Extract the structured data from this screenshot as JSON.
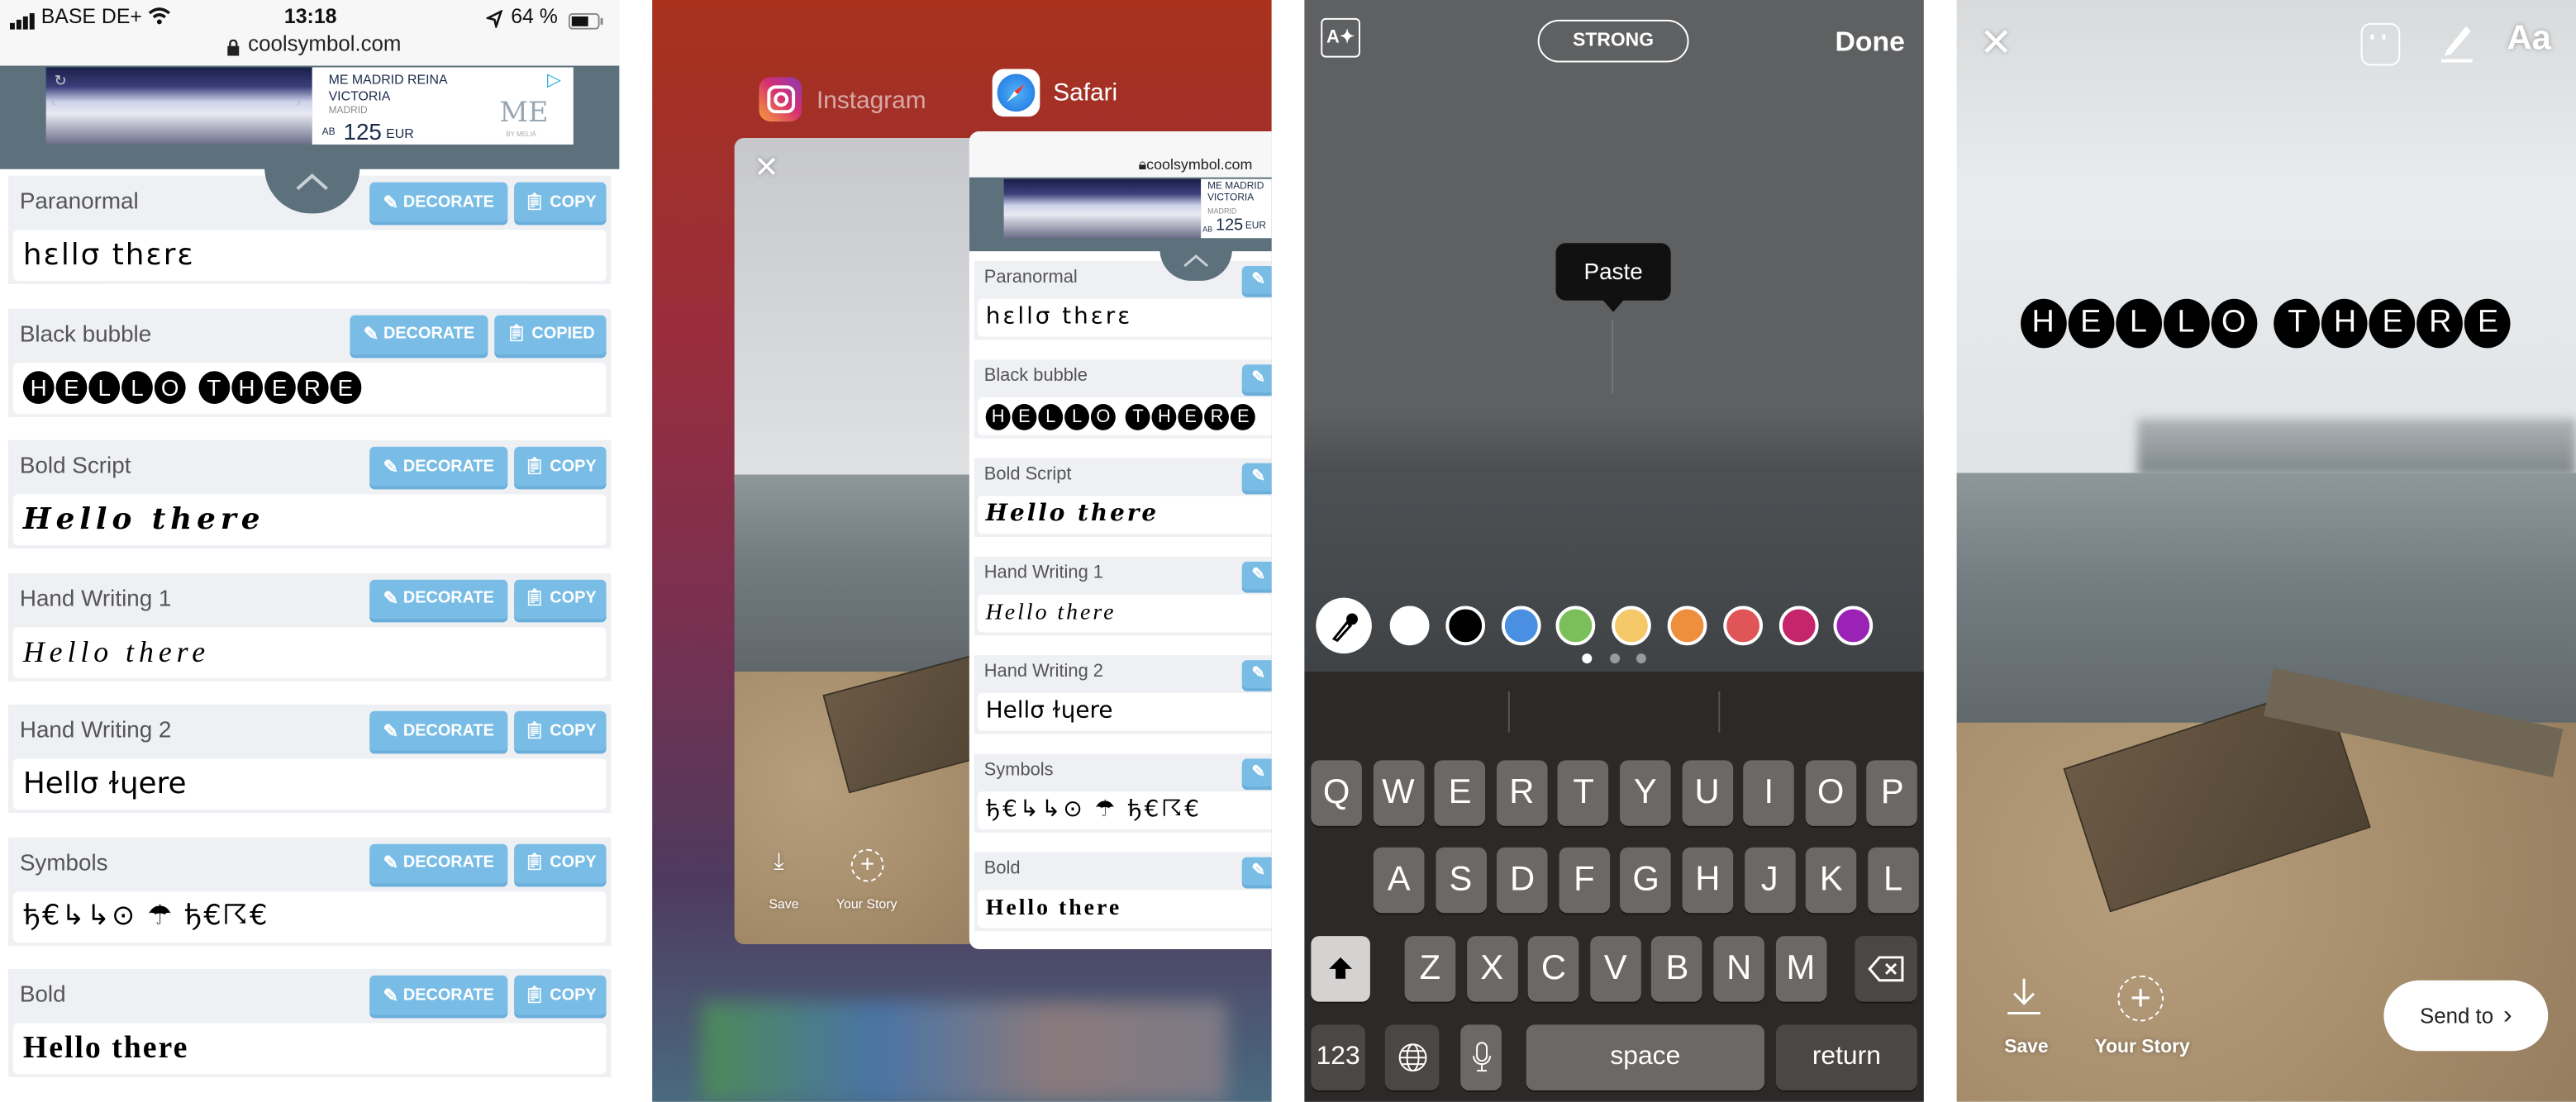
{
  "coolsymbol": {
    "status": {
      "carrier": "BASE DE+",
      "time": "13:18",
      "battery": "64 %"
    },
    "url": "coolsymbol.com",
    "ad": {
      "title_line1": "ME MADRID REINA",
      "title_line2": "VICTORIA",
      "city": "MADRID",
      "price_prefix": "AB",
      "price": "125",
      "currency": "EUR",
      "logo": "ME",
      "logo_sub": "BY MELIÁ"
    },
    "decorate_label": "DECORATE",
    "sections": [
      {
        "label": "Paranormal",
        "text": "hɛllσ thɛrɛ",
        "style": "para",
        "copy_label": "COPY"
      },
      {
        "label": "Black bubble",
        "text": "HELLO THERE",
        "style": "bubble",
        "copy_label": "COPIED"
      },
      {
        "label": "Bold Script",
        "text": "Hello there",
        "style": "script",
        "copy_label": "COPY"
      },
      {
        "label": "Hand Writing 1",
        "text": "Hello there",
        "style": "hand1",
        "copy_label": "COPY"
      },
      {
        "label": "Hand Writing 2",
        "text": "Hellσ ɫɥere",
        "style": "hand2",
        "copy_label": "COPY"
      },
      {
        "label": "Symbols",
        "text": "ђ€↳↳⊙ ☂ ђ€☈€",
        "style": "sym",
        "copy_label": "COPY"
      },
      {
        "label": "Bold",
        "text": "Hello there",
        "style": "bold",
        "copy_label": "COPY"
      }
    ]
  },
  "switcher": {
    "apps": [
      {
        "name": "Instagram"
      },
      {
        "name": "Safari"
      }
    ],
    "instagram_card": {
      "save": "Save",
      "your_story": "Your Story"
    },
    "safari_card": {
      "url": "coolsymbol.com",
      "ad_line1": "ME MADRID",
      "ad_line2": "VICTORIA",
      "ad_city": "MADRID",
      "ad_prefix": "AB",
      "ad_price": "125",
      "ad_currency": "EUR"
    }
  },
  "story_text_editor": {
    "style_button": "STRONG",
    "done": "Done",
    "paste": "Paste",
    "colors": [
      "#ffffff",
      "#000000",
      "#4a90e2",
      "#7bbf5b",
      "#f5c86a",
      "#ee8f3d",
      "#e05558",
      "#c5256a",
      "#9a23b5"
    ],
    "color_page": 1,
    "color_pages": 3,
    "keyboard": {
      "row1": [
        "Q",
        "W",
        "E",
        "R",
        "T",
        "Y",
        "U",
        "I",
        "O",
        "P"
      ],
      "row2": [
        "A",
        "S",
        "D",
        "F",
        "G",
        "H",
        "J",
        "K",
        "L"
      ],
      "row3": [
        "Z",
        "X",
        "C",
        "V",
        "B",
        "N",
        "M"
      ],
      "numbers": "123",
      "space": "space",
      "return": "return"
    }
  },
  "story_preview": {
    "text": "HELLO THERE",
    "aa": "Aa",
    "save": "Save",
    "your_story": "Your Story",
    "send_to": "Send to"
  }
}
